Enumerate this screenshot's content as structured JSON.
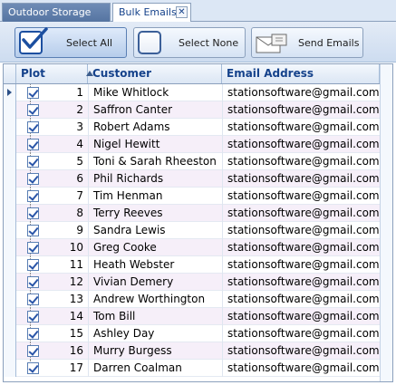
{
  "tabs": [
    {
      "label": "Outdoor Storage",
      "active": false
    },
    {
      "label": "Bulk Emails",
      "active": true,
      "close_glyph": "✕"
    }
  ],
  "toolbar": {
    "select_all_label": "Select All",
    "select_none_label": "Select None",
    "send_emails_label": "Send Emails"
  },
  "grid": {
    "columns": {
      "plot": "Plot",
      "customer": "Customer",
      "email": "Email Address"
    },
    "sort_column": "plot",
    "sort_direction": "ascending",
    "current_row": 1,
    "rows": [
      {
        "num": "1",
        "customer": "Mike Whitlock",
        "email": "stationsoftware@gmail.com",
        "checked": true
      },
      {
        "num": "2",
        "customer": "Saffron Canter",
        "email": "stationsoftware@gmail.com",
        "checked": true
      },
      {
        "num": "3",
        "customer": "Robert Adams",
        "email": "stationsoftware@gmail.com",
        "checked": true
      },
      {
        "num": "4",
        "customer": "Nigel Hewitt",
        "email": "stationsoftware@gmail.com",
        "checked": true
      },
      {
        "num": "5",
        "customer": "Toni & Sarah Rheeston",
        "email": "stationsoftware@gmail.com",
        "checked": true
      },
      {
        "num": "6",
        "customer": "Phil Richards",
        "email": "stationsoftware@gmail.com",
        "checked": true
      },
      {
        "num": "7",
        "customer": "Tim Henman",
        "email": "stationsoftware@gmail.com",
        "checked": true
      },
      {
        "num": "8",
        "customer": "Terry Reeves",
        "email": "stationsoftware@gmail.com",
        "checked": true
      },
      {
        "num": "9",
        "customer": "Sandra Lewis",
        "email": "stationsoftware@gmail.com",
        "checked": true
      },
      {
        "num": "10",
        "customer": "Greg Cooke",
        "email": "stationsoftware@gmail.com",
        "checked": true
      },
      {
        "num": "11",
        "customer": "Heath Webster",
        "email": "stationsoftware@gmail.com",
        "checked": true
      },
      {
        "num": "12",
        "customer": "Vivian Demery",
        "email": "stationsoftware@gmail.com",
        "checked": true
      },
      {
        "num": "13",
        "customer": "Andrew Worthington",
        "email": "stationsoftware@gmail.com",
        "checked": true
      },
      {
        "num": "14",
        "customer": "Tom Bill",
        "email": "stationsoftware@gmail.com",
        "checked": true
      },
      {
        "num": "15",
        "customer": "Ashley Day",
        "email": "stationsoftware@gmail.com",
        "checked": true
      },
      {
        "num": "16",
        "customer": "Murry Burgess",
        "email": "stationsoftware@gmail.com",
        "checked": true
      },
      {
        "num": "17",
        "customer": "Darren Coalman",
        "email": "stationsoftware@gmail.com",
        "checked": true
      }
    ]
  },
  "colors": {
    "accent": "#15428b",
    "alt_row": "#f6eff9",
    "tab_inactive": "#5574a1"
  }
}
